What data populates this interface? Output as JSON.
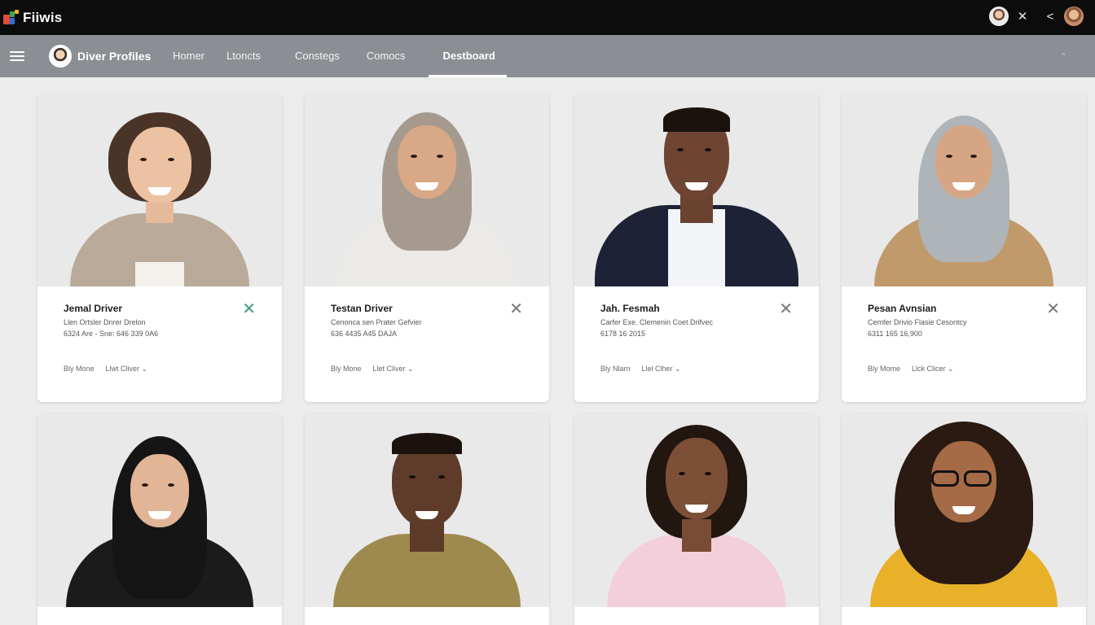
{
  "app": {
    "name": "Fiiwis"
  },
  "topbar": {
    "icons": [
      "user-avatar",
      "close-icon",
      "share-icon",
      "account-avatar"
    ]
  },
  "nav": {
    "brand": "Diver Profiles",
    "links": [
      "Homer",
      "Ltoncts",
      "Constegs",
      "Comocs",
      "Destboard"
    ],
    "active": "Destboard"
  },
  "cards": [
    {
      "name": "Jemal Driver",
      "meta": "Llen Ortsler Dnrer Drelon",
      "meta2": "6324 Are - Sne: 646 339 0A6",
      "action1": "Bly Mone",
      "action2": "Llwt Cliver ⌄",
      "close_color": "#3c9d78"
    },
    {
      "name": "Testan Driver",
      "meta": "Cenonca sen Prater Gefvier",
      "meta2": "636 4435 A45 DAJA",
      "action1": "Bly Mone",
      "action2": "Llet Cliver ⌄",
      "close_color": "#777777"
    },
    {
      "name": "Jah. Fesmah",
      "meta": "Carfer Exe. Clemenin Coet Drifvec",
      "meta2": "6178 16 2015",
      "action1": "Bly Nlarn",
      "action2": "Llel Clher ⌄",
      "close_color": "#777777"
    },
    {
      "name": "Pesan Avnsian",
      "meta": "Cemfer Drivio Flasie Cesontcy",
      "meta2": "6311 165 16,900",
      "action1": "Bly Mome",
      "action2": "Llck Clicer ⌄",
      "close_color": "#777777"
    }
  ]
}
